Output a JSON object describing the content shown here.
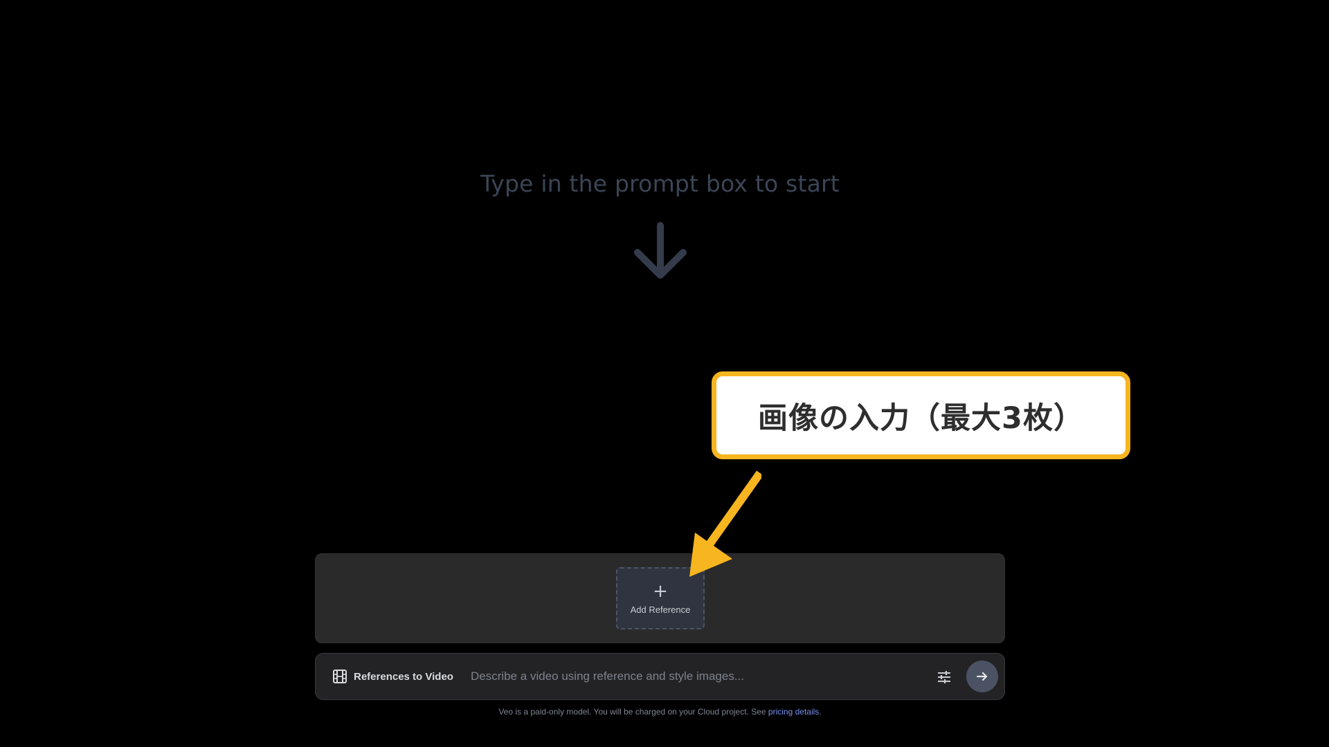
{
  "empty_state": {
    "title": "Type in the prompt box to start",
    "arrow_icon": "arrow-down-icon"
  },
  "reference_panel": {
    "add_reference": {
      "plus": "+",
      "label": "Add Reference"
    }
  },
  "prompt_bar": {
    "mode_icon": "film-icon",
    "mode_label": "References to Video",
    "input_placeholder": "Describe a video using reference and style images...",
    "input_value": "",
    "settings_icon": "sliders-icon",
    "send_icon": "arrow-right-icon"
  },
  "footer": {
    "text": "Veo is a paid-only model. You will be charged on your Cloud project. See ",
    "link_text": "pricing details",
    "suffix": "."
  },
  "annotation": {
    "callout_text": "画像の入力（最大3枚）"
  },
  "colors": {
    "background": "#000000",
    "callout_border": "#f7b51f",
    "callout_arrow": "#f7b51f",
    "link": "#7a8ff0",
    "send_button": "#4a5263"
  }
}
